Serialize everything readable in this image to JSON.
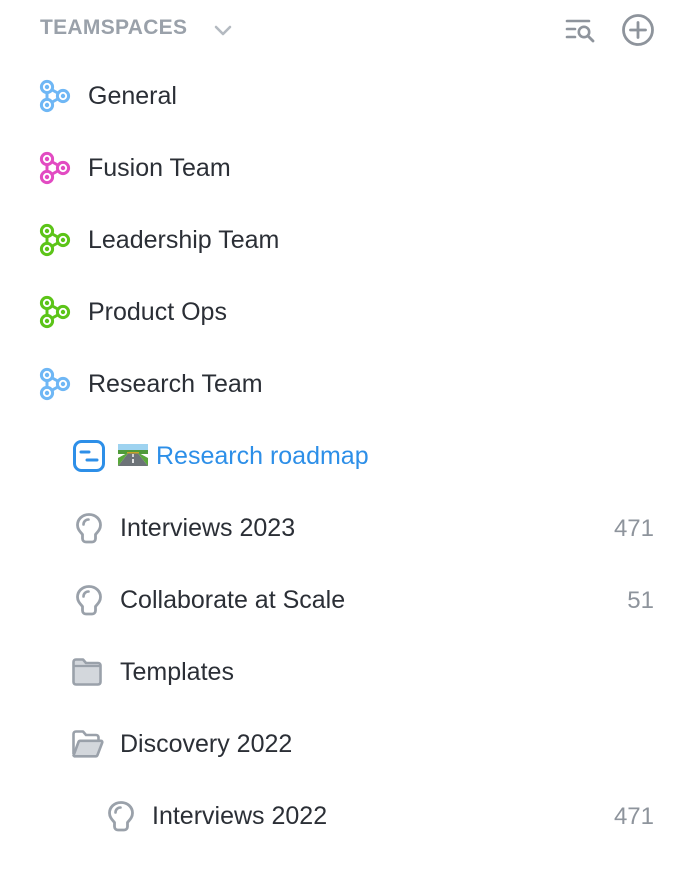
{
  "header": {
    "title": "TEAMSPACES"
  },
  "teamspaces": [
    {
      "label": "General",
      "color": "#6fb7f5"
    },
    {
      "label": "Fusion Team",
      "color": "#e24bc2"
    },
    {
      "label": "Leadership Team",
      "color": "#5cc418"
    },
    {
      "label": "Product Ops",
      "color": "#5cc418"
    },
    {
      "label": "Research Team",
      "color": "#6fb7f5"
    }
  ],
  "research_items": [
    {
      "label": "Research roadmap",
      "icon": "roadmap-icon",
      "active": true
    },
    {
      "label": "Interviews 2023",
      "icon": "lightbulb-icon",
      "count": "471"
    },
    {
      "label": "Collaborate at Scale",
      "icon": "lightbulb-icon",
      "count": "51"
    },
    {
      "label": "Templates",
      "icon": "folder-icon"
    },
    {
      "label": "Discovery 2022",
      "icon": "folder-open-icon"
    }
  ],
  "nested_items": [
    {
      "label": "Interviews 2022",
      "icon": "lightbulb-icon",
      "count": "471"
    }
  ],
  "colors": {
    "accent": "#2d8fe8",
    "muted": "#9aa1aa",
    "icon_gray": "#9aa1aa"
  }
}
